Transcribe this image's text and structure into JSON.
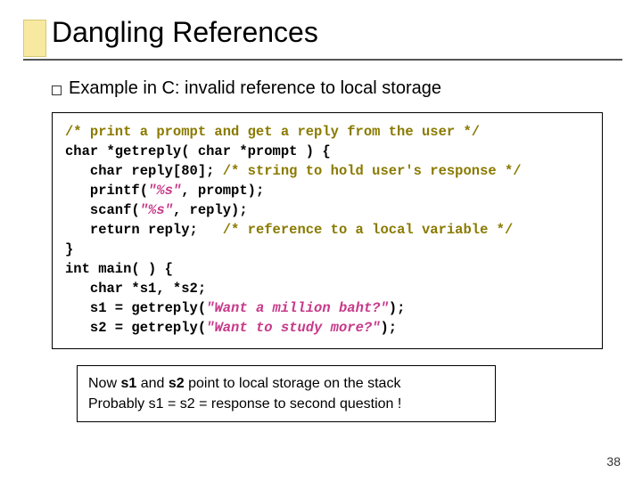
{
  "title": "Dangling References",
  "bullet": "Example in C: invalid reference to local storage",
  "code": {
    "c1": "/* print a prompt and get a reply from the user */",
    "l2": "char *getreply( char *prompt ) {",
    "l3a": "   char reply[80]; ",
    "c3b": "/* string to hold user's response */",
    "l4a": "   printf(",
    "s4b": "\"%s\"",
    "l4c": ", prompt);",
    "l5a": "   scanf(",
    "s5b": "\"%s\"",
    "l5c": ", reply);",
    "l6a": "   return reply;   ",
    "c6b": "/* reference to a local variable */",
    "l7": "}",
    "l8": "int main( ) {",
    "l9": "   char *s1, *s2;",
    "l10a": "   s1 = getreply(",
    "s10b": "\"Want a million baht?\"",
    "l10c": ");",
    "l11a": "   s2 = getreply(",
    "s11b": "\"Want to study more?\"",
    "l11c": ");"
  },
  "note": {
    "line1_a": "Now ",
    "line1_b": "s1",
    "line1_c": " and ",
    "line1_d": "s2",
    "line1_e": " point to local storage on the stack",
    "line2": "Probably s1 = s2 = response to second question !"
  },
  "page_number": "38"
}
